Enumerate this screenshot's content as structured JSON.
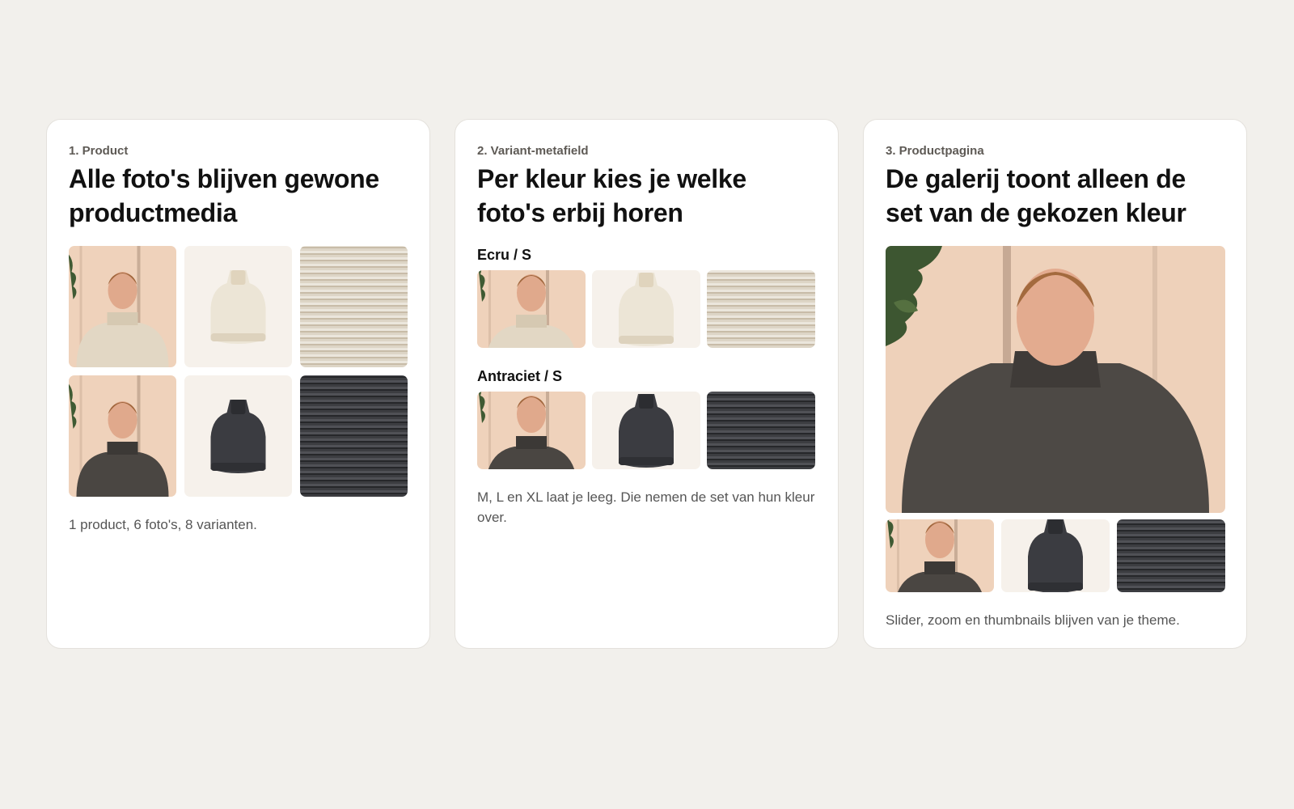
{
  "cards": [
    {
      "step": "1. Product",
      "title": "Alle foto's blijven gewone productmedia",
      "caption": "1 product, 6 foto's, 8 varianten."
    },
    {
      "step": "2. Variant-metafield",
      "title": "Per kleur kies je welke foto's erbij horen",
      "variants": [
        {
          "label": "Ecru / S"
        },
        {
          "label": "Antraciet / S"
        }
      ],
      "caption": "M, L en XL laat je leeg. Die nemen de set van hun kleur over."
    },
    {
      "step": "3. Productpagina",
      "title": "De galerij toont alleen de set van de gekozen kleur",
      "caption": "Slider, zoom en thumbnails blijven van je theme."
    }
  ],
  "photos": {
    "model": "model-photo",
    "flat": "flatlay-photo",
    "detail": "knit-detail-photo"
  },
  "colors": {
    "background": "#f2f0ec",
    "card": "#ffffff",
    "ecru": "#e6dccb",
    "antraciet": "#3b3c40",
    "wall": "#f0d3bc"
  }
}
